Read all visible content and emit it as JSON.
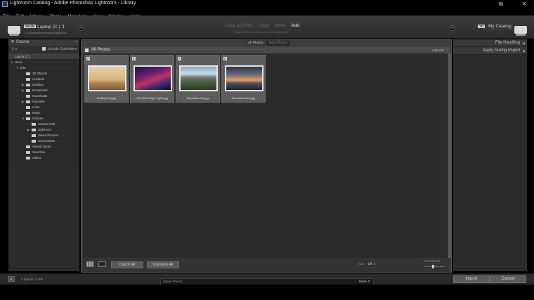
{
  "window": {
    "title": "Lightroom Catalog - Adobe Photoshop Lightroom - Library"
  },
  "menu": [
    "File",
    "Edit",
    "Library",
    "Photo",
    "Metadata",
    "View",
    "Window",
    "Help"
  ],
  "source_header": {
    "from_badge": "FROM",
    "source": "Laptop (C:) ⇕",
    "path": "C:\\Users\\julia\\Pictures\\Lightroom \\..."
  },
  "modes": {
    "items": [
      {
        "label": "Copy as DNG",
        "active": false
      },
      {
        "label": "Copy",
        "active": false
      },
      {
        "label": "Move",
        "active": false
      },
      {
        "label": "Add",
        "active": true
      }
    ],
    "description": "Add photos to catalog without moving them"
  },
  "dest_header": {
    "to_badge": "TO",
    "destination": "My Catalog"
  },
  "left_panel": {
    "title": "Source",
    "plus": "+",
    "include_subfolders": "Include Subfolders",
    "tree": [
      {
        "label": "Laptop (C:)",
        "level": 0,
        "type": "drive"
      },
      {
        "label": "Users",
        "level": 0,
        "tri": "▼"
      },
      {
        "label": "julia",
        "level": 1,
        "tri": "▼"
      },
      {
        "label": "3D Objects",
        "level": 2
      },
      {
        "label": "Contacts",
        "level": 2
      },
      {
        "label": "Desktop",
        "level": 2,
        "tri": "▶"
      },
      {
        "label": "Documents",
        "level": 2,
        "tri": "▶"
      },
      {
        "label": "Downloads",
        "level": 2
      },
      {
        "label": "Favorites",
        "level": 2,
        "tri": "▶"
      },
      {
        "label": "Links",
        "level": 2
      },
      {
        "label": "Music",
        "level": 2
      },
      {
        "label": "Pictures",
        "level": 2,
        "tri": "▼"
      },
      {
        "label": "Camera Roll",
        "level": 3
      },
      {
        "label": "Lightroom",
        "level": 3,
        "tri": "▶"
      },
      {
        "label": "Saved Pictures",
        "level": 3
      },
      {
        "label": "Screenshots",
        "level": 3
      },
      {
        "label": "Saved Games",
        "level": 2
      },
      {
        "label": "Searches",
        "level": 2
      },
      {
        "label": "Videos",
        "level": 2
      }
    ]
  },
  "grid": {
    "tabs": [
      {
        "label": "All Photos",
        "active": true
      },
      {
        "label": "New Photos",
        "active": false
      }
    ],
    "header_label": "All Photos",
    "count": "4 photos",
    "close": "×",
    "photos": [
      {
        "name": "Building Day.jpg",
        "style": "img-taj",
        "checked": true
      },
      {
        "name": "City Street Night Lights.jpg",
        "style": "img-city",
        "checked": true
      },
      {
        "name": "Mountains Sky.jpg",
        "style": "img-mtn",
        "checked": true
      },
      {
        "name": "Mountains Dusk.jpg",
        "style": "img-sun",
        "checked": true
      }
    ],
    "check_all": "Check All",
    "uncheck_all": "Uncheck All",
    "sort_label": "Sort",
    "sort_value": "Off ⇕",
    "thumbnails_label": "Thumbnails"
  },
  "right_panel": {
    "sections": [
      {
        "label": "File Handling",
        "tri": "◀"
      },
      {
        "label": "Apply During Import",
        "tri": "◀"
      }
    ]
  },
  "bottom_bar": {
    "info": "4 photos / 0 KB",
    "preset_label": "Import Preset :",
    "preset_value": "None ⇕",
    "import_button": "Import",
    "cancel_button": "Cancel"
  }
}
